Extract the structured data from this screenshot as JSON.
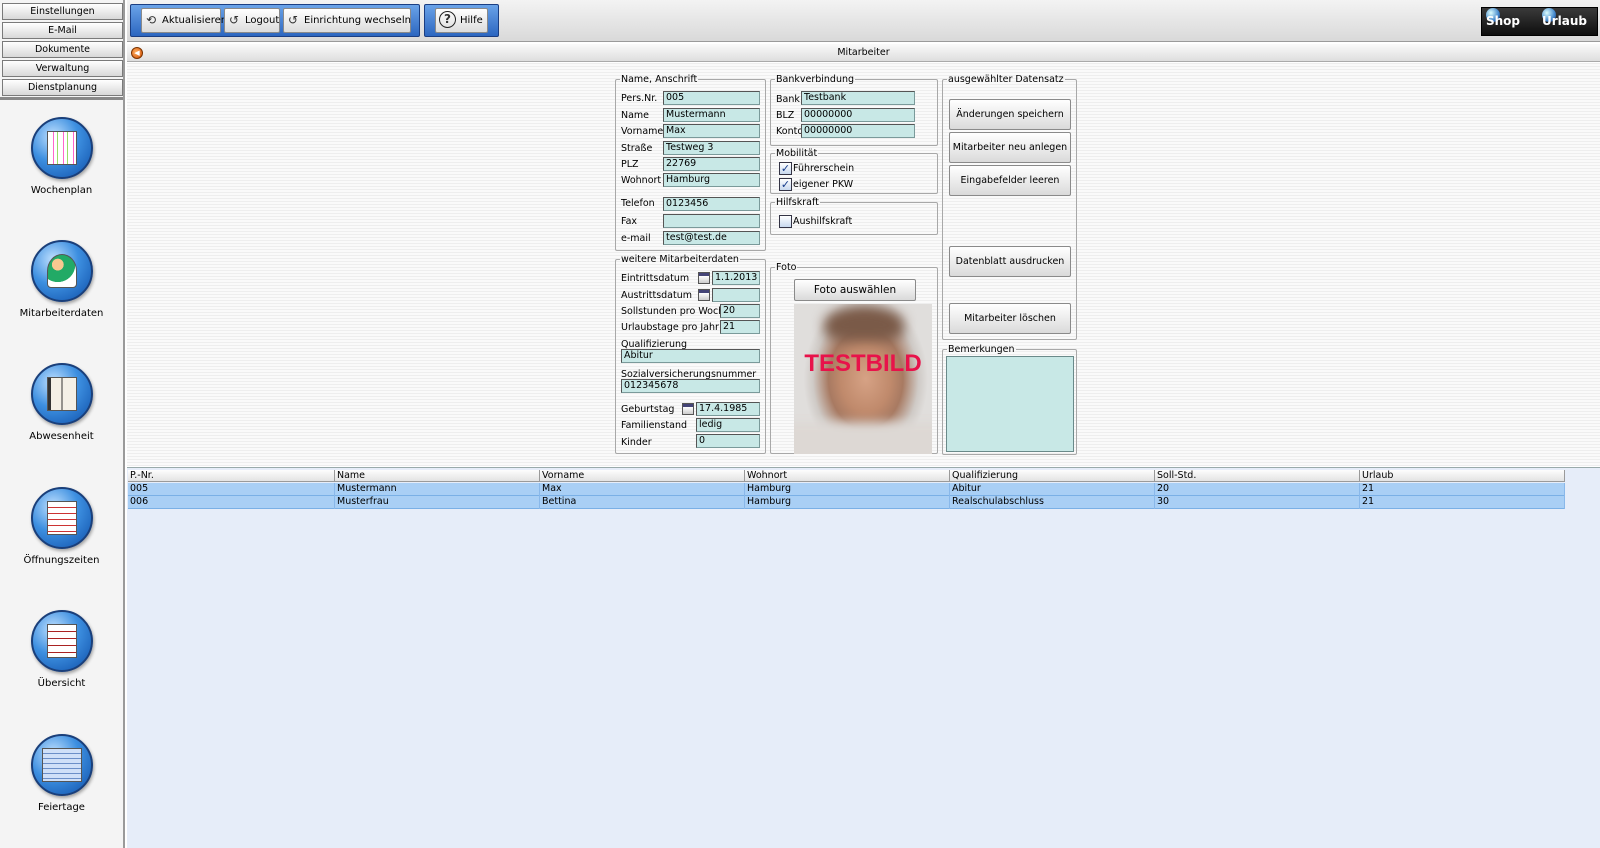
{
  "sidebar": {
    "top_items": [
      "Einstellungen",
      "E-Mail",
      "Dokumente",
      "Verwaltung",
      "Dienstplanung"
    ],
    "nav": [
      {
        "label": "Wochenplan",
        "icon": "calendar-icon"
      },
      {
        "label": "Mitarbeiterdaten",
        "icon": "people-icon"
      },
      {
        "label": "Abwesenheit",
        "icon": "book-icon"
      },
      {
        "label": "Öffnungszeiten",
        "icon": "clipboard-icon"
      },
      {
        "label": "Übersicht",
        "icon": "checklist-icon"
      },
      {
        "label": "Feiertage",
        "icon": "table-icon"
      }
    ]
  },
  "toolbar": {
    "refresh": "Aktualisieren",
    "logout": "Logout",
    "switch": "Einrichtung wechseln",
    "help": "Hilfe",
    "shop": "Shop",
    "vacation": "Urlaub"
  },
  "window": {
    "title": "Mitarbeiter"
  },
  "name_address": {
    "legend": "Name, Anschrift",
    "fields": [
      {
        "label": "Pers.Nr.",
        "value": "005"
      },
      {
        "label": "Name",
        "value": "Mustermann"
      },
      {
        "label": "Vorname",
        "value": "Max"
      },
      {
        "label": "Straße",
        "value": "Testweg 3"
      },
      {
        "label": "PLZ",
        "value": "22769"
      },
      {
        "label": "Wohnort",
        "value": "Hamburg"
      },
      {
        "label": "Telefon",
        "value": "0123456"
      },
      {
        "label": "Fax",
        "value": ""
      },
      {
        "label": "e-mail",
        "value": "test@test.de"
      }
    ]
  },
  "more_data": {
    "legend": "weitere Mitarbeiterdaten",
    "eintritt_label": "Eintrittsdatum",
    "eintritt_value": "1.1.2013",
    "austritt_label": "Austrittsdatum",
    "austritt_value": "",
    "soll_label": "Sollstunden pro Woche",
    "soll_value": "20",
    "urlaub_label": "Urlaubstage pro Jahr",
    "urlaub_value": "21",
    "quali_label": "Qualifizierung",
    "quali_value": "Abitur",
    "svn_label": "Sozialversicherungsnummer",
    "svn_value": "012345678",
    "geburt_label": "Geburtstag",
    "geburt_value": "17.4.1985",
    "famstand_label": "Familienstand",
    "famstand_value": "ledig",
    "kinder_label": "Kinder",
    "kinder_value": "0"
  },
  "bank": {
    "legend": "Bankverbindung",
    "bank_label": "Bank",
    "bank_value": "Testbank",
    "blz_label": "BLZ",
    "blz_value": "00000000",
    "konto_label": "Konto",
    "konto_value": "00000000"
  },
  "mobility": {
    "legend": "Mobilität",
    "license": "Führerschein",
    "license_checked": true,
    "car": "eigener PKW",
    "car_checked": true
  },
  "helper": {
    "legend": "Hilfskraft",
    "label": "Aushilfskraft",
    "checked": false
  },
  "photo": {
    "legend": "Foto",
    "button": "Foto auswählen",
    "overlay": "TESTBILD"
  },
  "record": {
    "legend": "ausgewählter Datensatz",
    "save": "Änderungen speichern",
    "new": "Mitarbeiter neu anlegen",
    "clear": "Eingabefelder leeren",
    "print": "Datenblatt ausdrucken",
    "delete": "Mitarbeiter löschen"
  },
  "remarks": {
    "legend": "Bemerkungen",
    "value": ""
  },
  "table": {
    "columns": [
      "P.-Nr.",
      "Name",
      "Vorname",
      "Wohnort",
      "Qualifizierung",
      "Soll-Std.",
      "Urlaub"
    ],
    "rows": [
      [
        "005",
        "Mustermann",
        "Max",
        "Hamburg",
        "Abitur",
        "20",
        "21"
      ],
      [
        "006",
        "Musterfrau",
        "Bettina",
        "Hamburg",
        "Realschulabschluss",
        "30",
        "21"
      ]
    ]
  }
}
